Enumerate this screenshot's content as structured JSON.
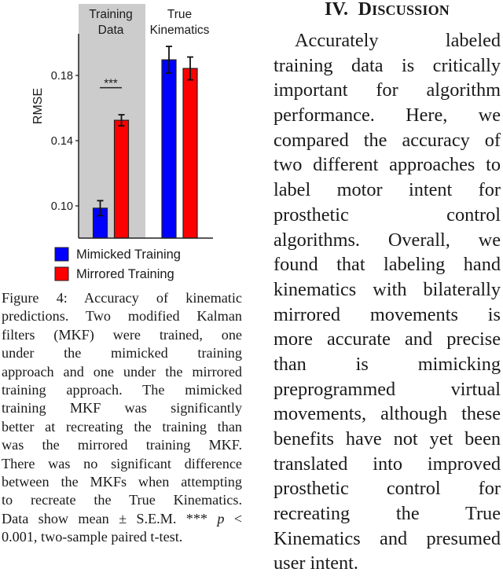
{
  "chart_data": {
    "type": "bar",
    "title": "",
    "xlabel": "",
    "ylabel": "RMSE",
    "ylim": [
      0.08,
      0.205
    ],
    "yticks": [
      0.1,
      0.14,
      0.18
    ],
    "ytick_labels": [
      "0.10",
      "0.14",
      "0.18"
    ],
    "grid": false,
    "groups": [
      {
        "label_lines": [
          "Training",
          "Data"
        ],
        "shaded": true,
        "shade_color": "#cccccc"
      },
      {
        "label_lines": [
          "True",
          "Kinematics"
        ],
        "shaded": false
      }
    ],
    "categories": [
      "Training Data",
      "True Kinematics"
    ],
    "series": [
      {
        "name": "Mimicked Training",
        "color": "#0000ff",
        "values": [
          0.0986,
          0.1896
        ],
        "errors": [
          0.0046,
          0.0082
        ]
      },
      {
        "name": "Mirrored Training",
        "color": "#ff0000",
        "values": [
          0.1525,
          0.1843
        ],
        "errors": [
          0.0034,
          0.007
        ]
      }
    ],
    "annotations": [
      {
        "text": "***",
        "group": 0,
        "type": "significance-bar",
        "y": 0.1725
      }
    ],
    "legend_position": "bottom-left"
  },
  "caption": {
    "lines": [
      "Figure 4: Accuracy of kinematic",
      "predictions. Two modified Kalman",
      "filters (MKF) were trained, one",
      "under the mimicked training",
      "approach and one under the mirrored",
      "training approach. The mimicked",
      "training MKF was significantly",
      "better at recreating the training than",
      "was the mirrored training MKF.",
      "There was no significant difference",
      "between the MKFs when attempting",
      "to recreate the True Kinematics.",
      "Data show mean ± S.E.M. *** p <",
      "0.001, two-sample paired t-test."
    ]
  },
  "section": {
    "number": "IV.",
    "title_initial": "D",
    "title_rest": "ISCUSSION",
    "paragraph_lines": [
      "Accurately labeled",
      "training data is critically",
      "important for algorithm",
      "performance. Here, we",
      "compared the accuracy of",
      "two different approaches to",
      "label motor intent for",
      "prosthetic control",
      "algorithms. Overall, we",
      "found that labeling hand",
      "kinematics with bilaterally",
      "mirrored movements is",
      "more accurate and precise",
      "than is mimicking",
      "preprogrammed virtual",
      "movements, although these",
      "benefits have not yet been",
      "translated into improved",
      "prosthetic control for",
      "recreating the True",
      "Kinematics and presumed",
      "user intent."
    ]
  }
}
